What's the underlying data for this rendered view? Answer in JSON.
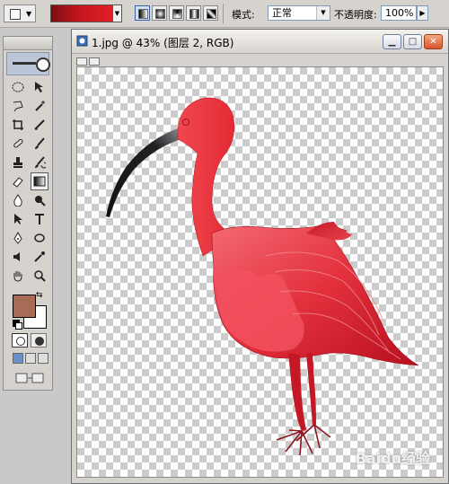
{
  "options_bar": {
    "mode_label": "模式:",
    "mode_value": "正常",
    "opacity_label": "不透明度:",
    "opacity_value": "100%",
    "gradient_colors": [
      "#7d0d12",
      "#c4161f",
      "#e02027"
    ]
  },
  "toolbox": {
    "foreground_color": "#a86b56",
    "background_color": "#ffffff",
    "tools": [
      [
        "marquee-tool",
        "move-tool"
      ],
      [
        "lasso-tool",
        "magic-wand-tool"
      ],
      [
        "crop-tool",
        "slice-tool"
      ],
      [
        "healing-brush-tool",
        "brush-tool"
      ],
      [
        "clone-stamp-tool",
        "history-brush-tool"
      ],
      [
        "eraser-tool",
        "gradient-tool"
      ],
      [
        "blur-tool",
        "dodge-tool"
      ],
      [
        "path-selection-tool",
        "type-tool"
      ],
      [
        "pen-tool",
        "shape-tool"
      ],
      [
        "notes-tool",
        "eyedropper-tool"
      ],
      [
        "hand-tool",
        "zoom-tool"
      ]
    ],
    "active_tool": "gradient-tool"
  },
  "document": {
    "title": "1.jpg @ 43% (图层 2, RGB)",
    "bird_colors": {
      "body_light": "#f2515e",
      "body_dark": "#b8101f",
      "beak": "#1a1a1a"
    }
  },
  "watermark": "Baidu经验"
}
